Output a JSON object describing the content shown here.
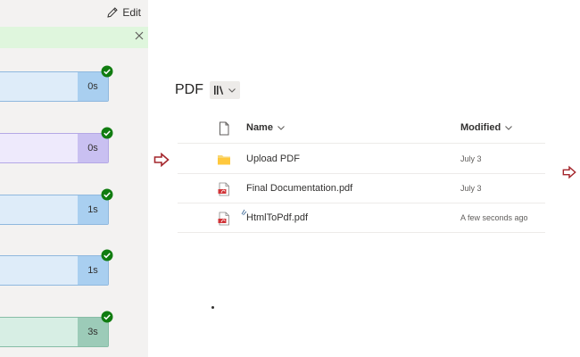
{
  "flow_panel": {
    "edit_label": "Edit",
    "steps": [
      {
        "duration": "0s",
        "fill": "#deecf9",
        "dur_fill": "#a9cff0",
        "border": "#8fb8de"
      },
      {
        "duration": "0s",
        "fill": "#eeeafc",
        "dur_fill": "#c9c0f1",
        "border": "#b4a8e6"
      },
      {
        "duration": "1s",
        "fill": "#deecf9",
        "dur_fill": "#a9cff0",
        "border": "#8fb8de"
      },
      {
        "duration": "1s",
        "fill": "#deecf9",
        "dur_fill": "#a9cff0",
        "border": "#8fb8de"
      },
      {
        "duration": "3s",
        "fill": "#d7eee4",
        "dur_fill": "#9ccbb8",
        "border": "#86bda6"
      }
    ],
    "success_color": "#107c10",
    "icons": {
      "edit": "pencil-icon",
      "close": "close-icon",
      "check": "check-circle-icon"
    }
  },
  "arrow_color": "#a4262c",
  "library": {
    "title": "PDF",
    "columns": {
      "name": "Name",
      "modified": "Modified"
    },
    "rows": [
      {
        "name": "Upload PDF",
        "modified": "July 3",
        "icon": "folder-icon"
      },
      {
        "name": "Final Documentation.pdf",
        "modified": "July 3",
        "icon": "pdf-file-icon"
      },
      {
        "name": "HtmlToPdf.pdf",
        "modified": "A few seconds ago",
        "icon": "pdf-file-icon"
      }
    ]
  }
}
